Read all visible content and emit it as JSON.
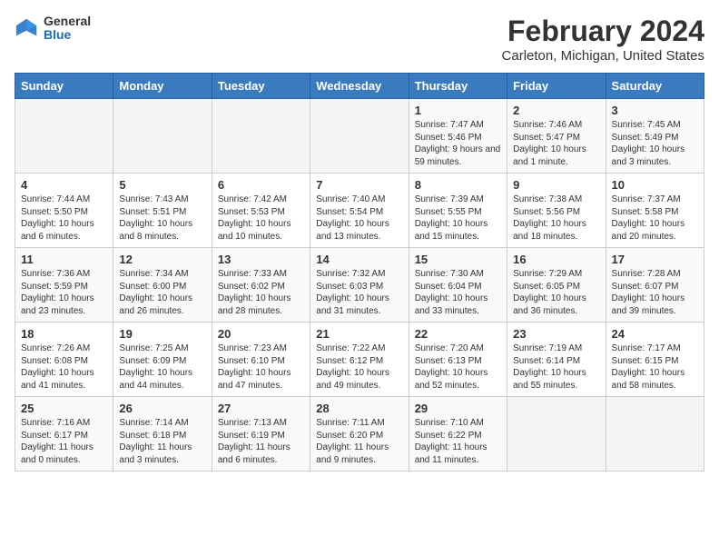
{
  "header": {
    "logo_general": "General",
    "logo_blue": "Blue",
    "main_title": "February 2024",
    "subtitle": "Carleton, Michigan, United States"
  },
  "days_of_week": [
    "Sunday",
    "Monday",
    "Tuesday",
    "Wednesday",
    "Thursday",
    "Friday",
    "Saturday"
  ],
  "weeks": [
    [
      {
        "day": "",
        "sunrise": "",
        "sunset": "",
        "daylight": "",
        "empty": true
      },
      {
        "day": "",
        "sunrise": "",
        "sunset": "",
        "daylight": "",
        "empty": true
      },
      {
        "day": "",
        "sunrise": "",
        "sunset": "",
        "daylight": "",
        "empty": true
      },
      {
        "day": "",
        "sunrise": "",
        "sunset": "",
        "daylight": "",
        "empty": true
      },
      {
        "day": "1",
        "sunrise": "Sunrise: 7:47 AM",
        "sunset": "Sunset: 5:46 PM",
        "daylight": "Daylight: 9 hours and 59 minutes.",
        "empty": false
      },
      {
        "day": "2",
        "sunrise": "Sunrise: 7:46 AM",
        "sunset": "Sunset: 5:47 PM",
        "daylight": "Daylight: 10 hours and 1 minute.",
        "empty": false
      },
      {
        "day": "3",
        "sunrise": "Sunrise: 7:45 AM",
        "sunset": "Sunset: 5:49 PM",
        "daylight": "Daylight: 10 hours and 3 minutes.",
        "empty": false
      }
    ],
    [
      {
        "day": "4",
        "sunrise": "Sunrise: 7:44 AM",
        "sunset": "Sunset: 5:50 PM",
        "daylight": "Daylight: 10 hours and 6 minutes.",
        "empty": false
      },
      {
        "day": "5",
        "sunrise": "Sunrise: 7:43 AM",
        "sunset": "Sunset: 5:51 PM",
        "daylight": "Daylight: 10 hours and 8 minutes.",
        "empty": false
      },
      {
        "day": "6",
        "sunrise": "Sunrise: 7:42 AM",
        "sunset": "Sunset: 5:53 PM",
        "daylight": "Daylight: 10 hours and 10 minutes.",
        "empty": false
      },
      {
        "day": "7",
        "sunrise": "Sunrise: 7:40 AM",
        "sunset": "Sunset: 5:54 PM",
        "daylight": "Daylight: 10 hours and 13 minutes.",
        "empty": false
      },
      {
        "day": "8",
        "sunrise": "Sunrise: 7:39 AM",
        "sunset": "Sunset: 5:55 PM",
        "daylight": "Daylight: 10 hours and 15 minutes.",
        "empty": false
      },
      {
        "day": "9",
        "sunrise": "Sunrise: 7:38 AM",
        "sunset": "Sunset: 5:56 PM",
        "daylight": "Daylight: 10 hours and 18 minutes.",
        "empty": false
      },
      {
        "day": "10",
        "sunrise": "Sunrise: 7:37 AM",
        "sunset": "Sunset: 5:58 PM",
        "daylight": "Daylight: 10 hours and 20 minutes.",
        "empty": false
      }
    ],
    [
      {
        "day": "11",
        "sunrise": "Sunrise: 7:36 AM",
        "sunset": "Sunset: 5:59 PM",
        "daylight": "Daylight: 10 hours and 23 minutes.",
        "empty": false
      },
      {
        "day": "12",
        "sunrise": "Sunrise: 7:34 AM",
        "sunset": "Sunset: 6:00 PM",
        "daylight": "Daylight: 10 hours and 26 minutes.",
        "empty": false
      },
      {
        "day": "13",
        "sunrise": "Sunrise: 7:33 AM",
        "sunset": "Sunset: 6:02 PM",
        "daylight": "Daylight: 10 hours and 28 minutes.",
        "empty": false
      },
      {
        "day": "14",
        "sunrise": "Sunrise: 7:32 AM",
        "sunset": "Sunset: 6:03 PM",
        "daylight": "Daylight: 10 hours and 31 minutes.",
        "empty": false
      },
      {
        "day": "15",
        "sunrise": "Sunrise: 7:30 AM",
        "sunset": "Sunset: 6:04 PM",
        "daylight": "Daylight: 10 hours and 33 minutes.",
        "empty": false
      },
      {
        "day": "16",
        "sunrise": "Sunrise: 7:29 AM",
        "sunset": "Sunset: 6:05 PM",
        "daylight": "Daylight: 10 hours and 36 minutes.",
        "empty": false
      },
      {
        "day": "17",
        "sunrise": "Sunrise: 7:28 AM",
        "sunset": "Sunset: 6:07 PM",
        "daylight": "Daylight: 10 hours and 39 minutes.",
        "empty": false
      }
    ],
    [
      {
        "day": "18",
        "sunrise": "Sunrise: 7:26 AM",
        "sunset": "Sunset: 6:08 PM",
        "daylight": "Daylight: 10 hours and 41 minutes.",
        "empty": false
      },
      {
        "day": "19",
        "sunrise": "Sunrise: 7:25 AM",
        "sunset": "Sunset: 6:09 PM",
        "daylight": "Daylight: 10 hours and 44 minutes.",
        "empty": false
      },
      {
        "day": "20",
        "sunrise": "Sunrise: 7:23 AM",
        "sunset": "Sunset: 6:10 PM",
        "daylight": "Daylight: 10 hours and 47 minutes.",
        "empty": false
      },
      {
        "day": "21",
        "sunrise": "Sunrise: 7:22 AM",
        "sunset": "Sunset: 6:12 PM",
        "daylight": "Daylight: 10 hours and 49 minutes.",
        "empty": false
      },
      {
        "day": "22",
        "sunrise": "Sunrise: 7:20 AM",
        "sunset": "Sunset: 6:13 PM",
        "daylight": "Daylight: 10 hours and 52 minutes.",
        "empty": false
      },
      {
        "day": "23",
        "sunrise": "Sunrise: 7:19 AM",
        "sunset": "Sunset: 6:14 PM",
        "daylight": "Daylight: 10 hours and 55 minutes.",
        "empty": false
      },
      {
        "day": "24",
        "sunrise": "Sunrise: 7:17 AM",
        "sunset": "Sunset: 6:15 PM",
        "daylight": "Daylight: 10 hours and 58 minutes.",
        "empty": false
      }
    ],
    [
      {
        "day": "25",
        "sunrise": "Sunrise: 7:16 AM",
        "sunset": "Sunset: 6:17 PM",
        "daylight": "Daylight: 11 hours and 0 minutes.",
        "empty": false
      },
      {
        "day": "26",
        "sunrise": "Sunrise: 7:14 AM",
        "sunset": "Sunset: 6:18 PM",
        "daylight": "Daylight: 11 hours and 3 minutes.",
        "empty": false
      },
      {
        "day": "27",
        "sunrise": "Sunrise: 7:13 AM",
        "sunset": "Sunset: 6:19 PM",
        "daylight": "Daylight: 11 hours and 6 minutes.",
        "empty": false
      },
      {
        "day": "28",
        "sunrise": "Sunrise: 7:11 AM",
        "sunset": "Sunset: 6:20 PM",
        "daylight": "Daylight: 11 hours and 9 minutes.",
        "empty": false
      },
      {
        "day": "29",
        "sunrise": "Sunrise: 7:10 AM",
        "sunset": "Sunset: 6:22 PM",
        "daylight": "Daylight: 11 hours and 11 minutes.",
        "empty": false
      },
      {
        "day": "",
        "sunrise": "",
        "sunset": "",
        "daylight": "",
        "empty": true
      },
      {
        "day": "",
        "sunrise": "",
        "sunset": "",
        "daylight": "",
        "empty": true
      }
    ]
  ]
}
